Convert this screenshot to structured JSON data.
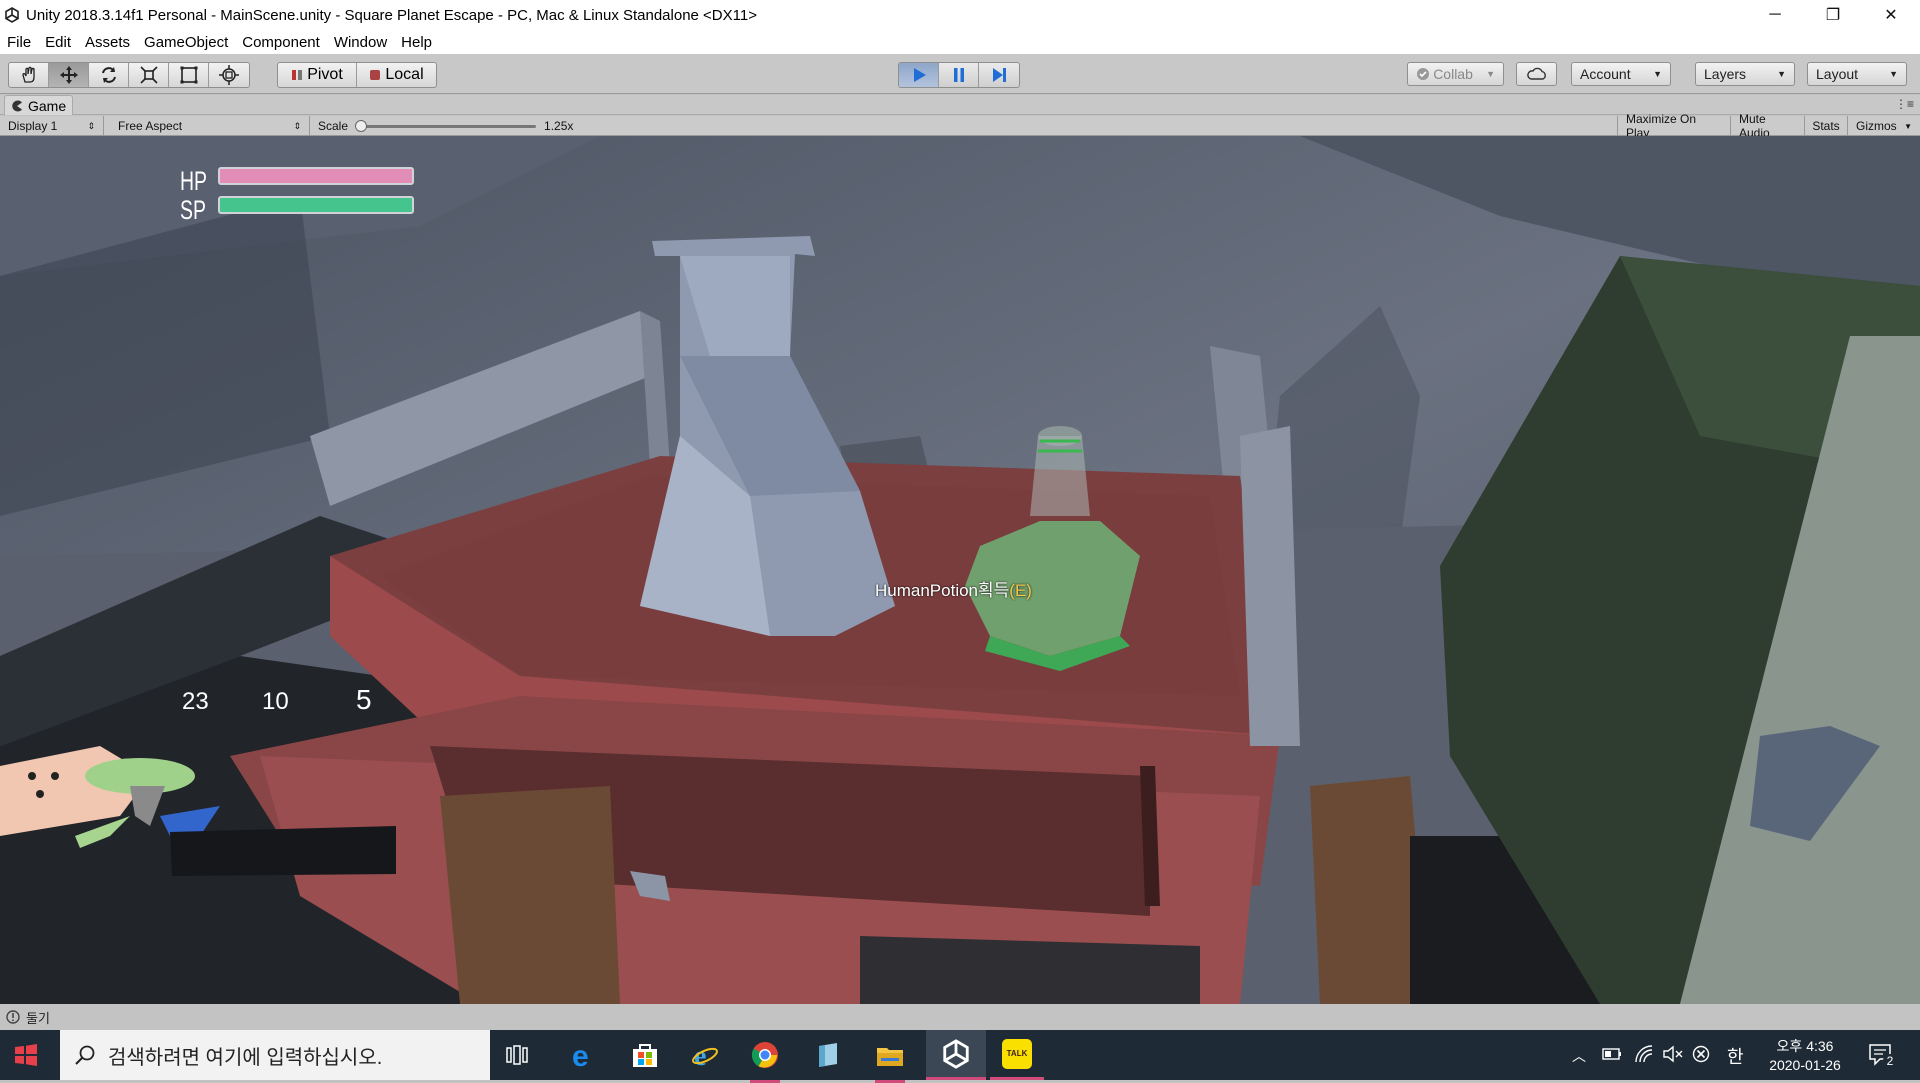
{
  "window": {
    "title": "Unity 2018.3.14f1 Personal - MainScene.unity - Square Planet Escape - PC, Mac & Linux Standalone <DX11>",
    "minimize": "─",
    "restore": "❐",
    "close": "✕"
  },
  "menu": [
    "File",
    "Edit",
    "Assets",
    "GameObject",
    "Component",
    "Window",
    "Help"
  ],
  "toolbar": {
    "pivot": "Pivot",
    "local": "Local",
    "collab": "Collab",
    "account": "Account",
    "layers": "Layers",
    "layout": "Layout"
  },
  "game_tab": {
    "label": "Game"
  },
  "game_bar": {
    "display": "Display 1",
    "aspect": "Free Aspect",
    "scale_label": "Scale",
    "scale_value": "1.25x",
    "maximize": "Maximize On Play",
    "mute": "Mute Audio",
    "stats": "Stats",
    "gizmos": "Gizmos"
  },
  "hud": {
    "hp_label": "HP",
    "sp_label": "SP",
    "hp_color": "#e28cb8",
    "sp_color": "#46c48e",
    "prompt_main": "HumanPotion획득",
    "prompt_key": "(E)",
    "ammo": [
      "23",
      "10",
      "5"
    ]
  },
  "status": {
    "text": "둘기"
  },
  "taskbar": {
    "search_placeholder": "검색하려면 여기에 입력하십시오.",
    "ampm_time": "오후 4:36",
    "date": "2020-01-26",
    "ime": "한",
    "notif_count": "2",
    "kakao": "TALK"
  }
}
